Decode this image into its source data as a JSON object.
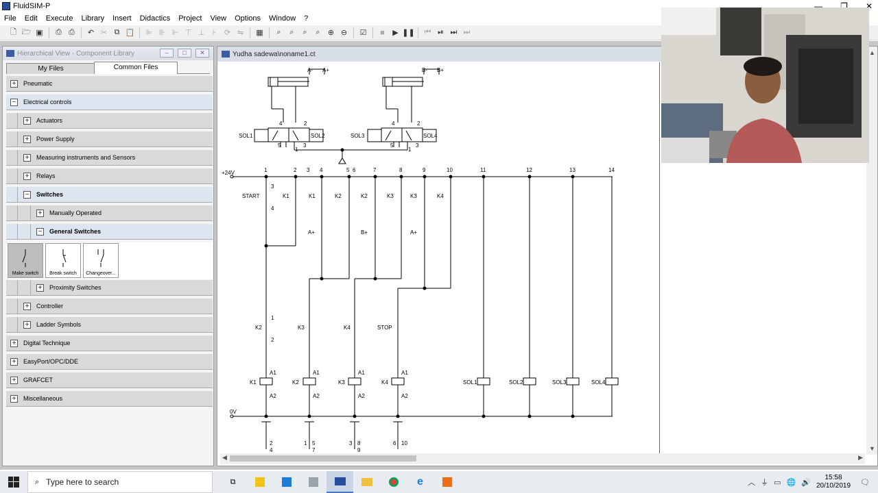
{
  "window": {
    "title": "FluidSIM-P"
  },
  "menu": [
    "File",
    "Edit",
    "Execute",
    "Library",
    "Insert",
    "Didactics",
    "Project",
    "View",
    "Options",
    "Window",
    "?"
  ],
  "library_panel": {
    "title": "Hierarchical View - Component Library",
    "tabs": {
      "my_files": "My Files",
      "common_files": "Common Files"
    },
    "tree": {
      "pneumatic": "Pneumatic",
      "electrical_controls": "Electrical controls",
      "actuators": "Actuators",
      "power_supply": "Power Supply",
      "measuring": "Measuring instruments and Sensors",
      "relays": "Relays",
      "switches": "Switches",
      "manually_operated": "Manually Operated",
      "general_switches": "General Switches",
      "proximity_switches": "Proximity Switches",
      "controller": "Controller",
      "ladder_symbols": "Ladder Symbols",
      "digital_technique": "Digital Technique",
      "easyport": "EasyPort/OPC/DDE",
      "grafcet": "GRAFCET",
      "miscellaneous": "Miscellaneous"
    },
    "components": {
      "make": "Make switch",
      "break": "Break switch",
      "changeover": "Changeover..."
    }
  },
  "document": {
    "title": "Yudha sadewa\\noname1.ct"
  },
  "diagram": {
    "cyl_a": {
      "minus": "A-",
      "plus": "A+"
    },
    "cyl_b": {
      "minus": "B-",
      "plus": "B+"
    },
    "valve1": {
      "left": "SOL1",
      "right": "SOL2"
    },
    "valve2": {
      "left": "SOL3",
      "right": "SOL4"
    },
    "port_4": "4",
    "port_2": "2",
    "port_5": "5",
    "port_1": "1",
    "port_3": "3",
    "supply": "+24V",
    "ground": "0V",
    "rung_numbers": [
      "1",
      "2",
      "3",
      "4",
      "5",
      "6",
      "7",
      "8",
      "9",
      "10",
      "11",
      "12",
      "13",
      "14"
    ],
    "top_contacts": [
      "START",
      "K1",
      "K1",
      "K2",
      "K2",
      "K3",
      "K3",
      "K4"
    ],
    "mid_contacts": [
      "A+",
      "B+",
      "A+"
    ],
    "stop_contacts": [
      "K2",
      "K3",
      "K4",
      "STOP"
    ],
    "coils": [
      "K1",
      "K2",
      "K3",
      "K4"
    ],
    "solenoids": [
      "SOL1",
      "SOL2",
      "SOL3",
      "SOL4"
    ],
    "cross_refs": [
      [
        "2",
        "4"
      ],
      [
        "1",
        "5",
        "7"
      ],
      [
        "3",
        "8",
        "9"
      ],
      [
        "6",
        "10"
      ]
    ],
    "term_3": "3",
    "term_4": "4",
    "term_1": "1",
    "term_2": "2",
    "term_a1": "A1",
    "term_a2": "A2"
  },
  "taskbar": {
    "search_placeholder": "Type here to search",
    "time": "15:58",
    "date": "20/10/2019"
  }
}
